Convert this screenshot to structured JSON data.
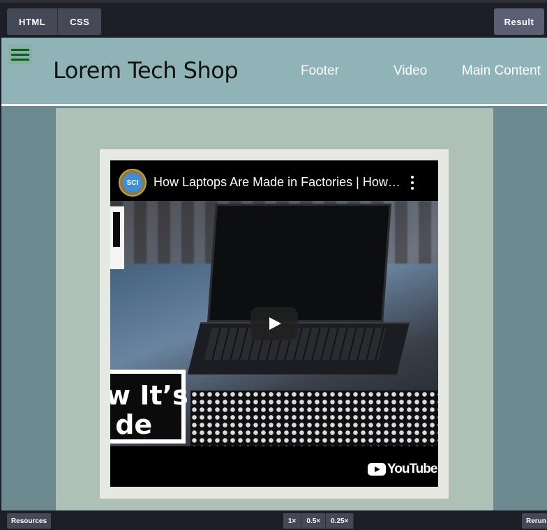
{
  "editor": {
    "tabs": [
      "HTML",
      "CSS"
    ],
    "result_label": "Result"
  },
  "site": {
    "brand": "Lorem Tech Shop",
    "nav": [
      "Footer",
      "Video",
      "Main Content"
    ]
  },
  "video": {
    "channel_initials": "SCI",
    "title": "How Laptops Are Made in Factories | How…",
    "overlay_text": "w It’s\n de",
    "youtube_label": "YouTube"
  },
  "bottombar": {
    "resources_label": "Resources",
    "zoom_options": [
      "1×",
      "0.5×",
      "0.25×"
    ],
    "rerun_label": "Rerun"
  },
  "colors": {
    "header_bg": "#8fb3b6",
    "main_bg": "#afc0b7",
    "side_bg": "#6d8a91",
    "hamburger_lines": "#0c5a1c"
  }
}
